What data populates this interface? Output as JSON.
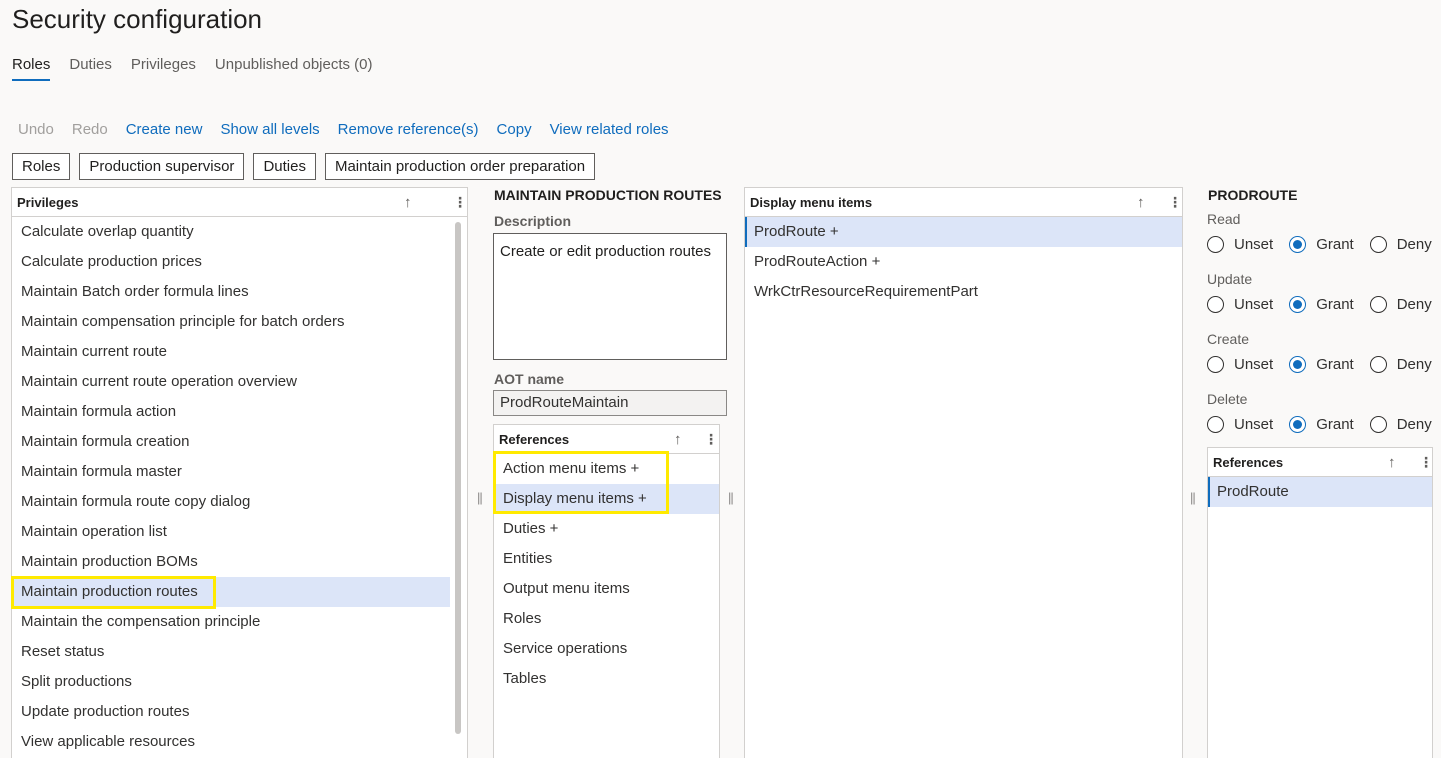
{
  "page_title": "Security configuration",
  "tabs": [
    {
      "label": "Roles",
      "active": true
    },
    {
      "label": "Duties"
    },
    {
      "label": "Privileges"
    },
    {
      "label": "Unpublished objects (0)"
    }
  ],
  "toolbar": {
    "undo": "Undo",
    "redo": "Redo",
    "create_new": "Create new",
    "show_all_levels": "Show all levels",
    "remove_references": "Remove reference(s)",
    "copy": "Copy",
    "view_related_roles": "View related roles"
  },
  "breadcrumb": [
    "Roles",
    "Production supervisor",
    "Duties",
    "Maintain production order preparation"
  ],
  "privileges_panel": {
    "header": "Privileges",
    "sort_icon": "sort-up-arrow-icon",
    "more_icon": "more-vertical-icon",
    "items": [
      "Calculate overlap quantity",
      "Calculate production prices",
      "Maintain Batch order formula lines",
      "Maintain compensation principle for batch orders",
      "Maintain current route",
      "Maintain current route operation overview",
      "Maintain formula action",
      "Maintain formula creation",
      "Maintain formula master",
      "Maintain formula route copy dialog",
      "Maintain operation list",
      "Maintain production BOMs",
      "Maintain production routes",
      "Maintain the compensation principle",
      "Reset status",
      "Split productions",
      "Update production routes",
      "View applicable resources"
    ],
    "selected_index": 12
  },
  "detail": {
    "title": "MAINTAIN PRODUCTION ROUTES",
    "description_label": "Description",
    "description_value": "Create or edit production routes",
    "aot_label": "AOT name",
    "aot_value": "ProdRouteMaintain",
    "references": {
      "header": "References",
      "items": [
        "Action menu items +",
        "Display menu items +",
        "Duties +",
        "Entities",
        "Output menu items",
        "Roles",
        "Service operations",
        "Tables"
      ],
      "selected_index": 1
    }
  },
  "menu_items_panel": {
    "header": "Display menu items",
    "items": [
      "ProdRoute +",
      "ProdRouteAction +",
      "WrkCtrResourceRequirementPart"
    ],
    "selected_index": 0
  },
  "permissions": {
    "title": "PRODROUTE",
    "option_labels": [
      "Unset",
      "Grant",
      "Deny"
    ],
    "groups": [
      {
        "label": "Read",
        "selected": "Grant"
      },
      {
        "label": "Update",
        "selected": "Grant"
      },
      {
        "label": "Create",
        "selected": "Grant"
      },
      {
        "label": "Delete",
        "selected": "Grant"
      }
    ],
    "references": {
      "header": "References",
      "items": [
        "ProdRoute"
      ],
      "selected_index": 0
    }
  },
  "splitter_glyph": "||",
  "colors": {
    "accent": "#0f6cbd",
    "selected_row": "#dce5f8",
    "highlight": "#ffea00",
    "background": "#faf9f8"
  }
}
